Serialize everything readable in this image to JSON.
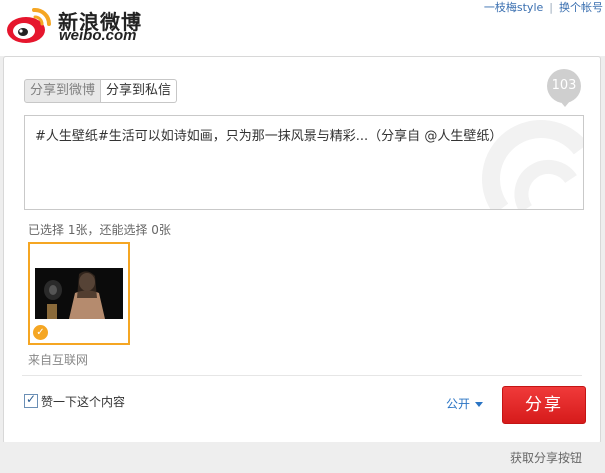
{
  "header": {
    "brand_cn": "新浪微博",
    "brand_en": "weibo.com",
    "user_link": "一枝梅style",
    "separator": "|",
    "switch_account": "换个帐号"
  },
  "share": {
    "tabs": [
      {
        "label": "分享到微博",
        "active": true
      },
      {
        "label": "分享到私信",
        "active": false
      }
    ],
    "remaining_count": "103",
    "text": "#人生壁纸#生活可以如诗如画，只为那一抹风景与精彩...（分享自 @人生壁纸）",
    "selection_hint": "已选择 1张，还能选择 0张",
    "image": {
      "selected": true,
      "icon": "check-icon"
    },
    "source_label": "来自互联网",
    "like_checkbox": {
      "label": "赞一下这个内容",
      "checked": true
    },
    "visibility": "公开",
    "submit_label": "分享",
    "get_button": "获取分享按钮"
  },
  "colors": {
    "accent": "#f5a623",
    "primary_button": "#e02828",
    "link": "#2a74c4"
  }
}
